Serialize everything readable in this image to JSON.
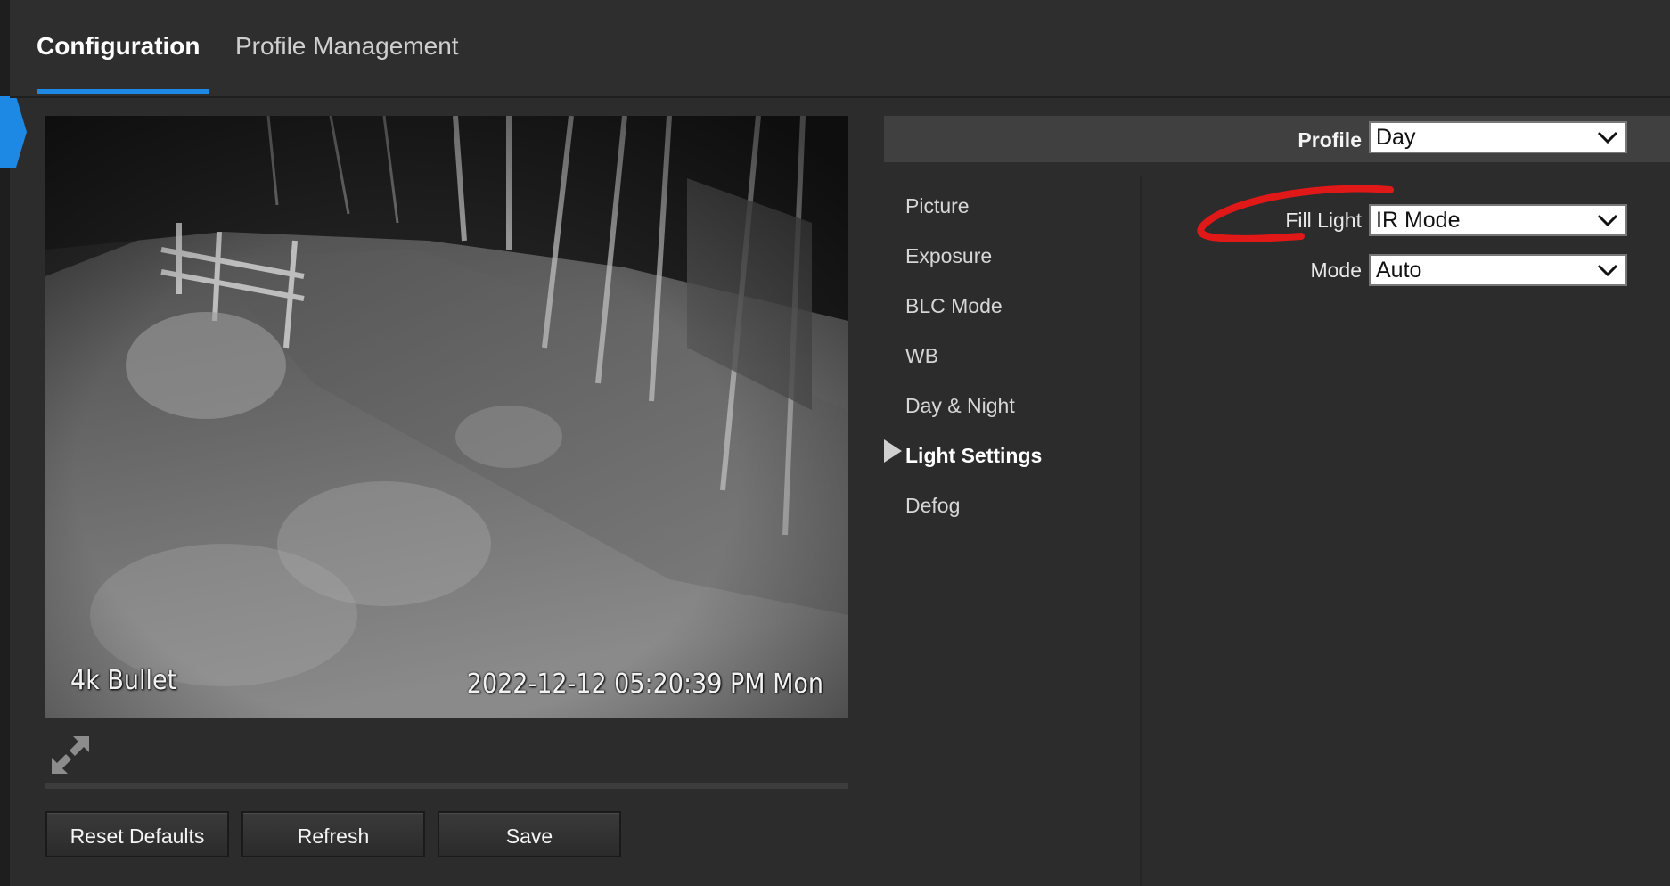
{
  "tabs": [
    {
      "label": "Configuration",
      "active": true
    },
    {
      "label": "Profile Management",
      "active": false
    }
  ],
  "video": {
    "osd_name": "4k Bullet",
    "osd_timestamp": "2022-12-12 05:20:39 PM Mon"
  },
  "buttons": {
    "reset": "Reset Defaults",
    "refresh": "Refresh",
    "save": "Save"
  },
  "profile": {
    "label": "Profile",
    "value": "Day"
  },
  "menu": {
    "items": [
      {
        "label": "Picture"
      },
      {
        "label": "Exposure"
      },
      {
        "label": "BLC Mode"
      },
      {
        "label": "WB"
      },
      {
        "label": "Day & Night"
      },
      {
        "label": "Light Settings",
        "active": true
      },
      {
        "label": "Defog"
      }
    ]
  },
  "light_settings": {
    "fill_light_label": "Fill Light",
    "fill_light_value": "IR Mode",
    "mode_label": "Mode",
    "mode_value": "Auto"
  },
  "colors": {
    "accent": "#1e88e5",
    "annotation": "#e01818",
    "background": "#2c2c2c"
  }
}
